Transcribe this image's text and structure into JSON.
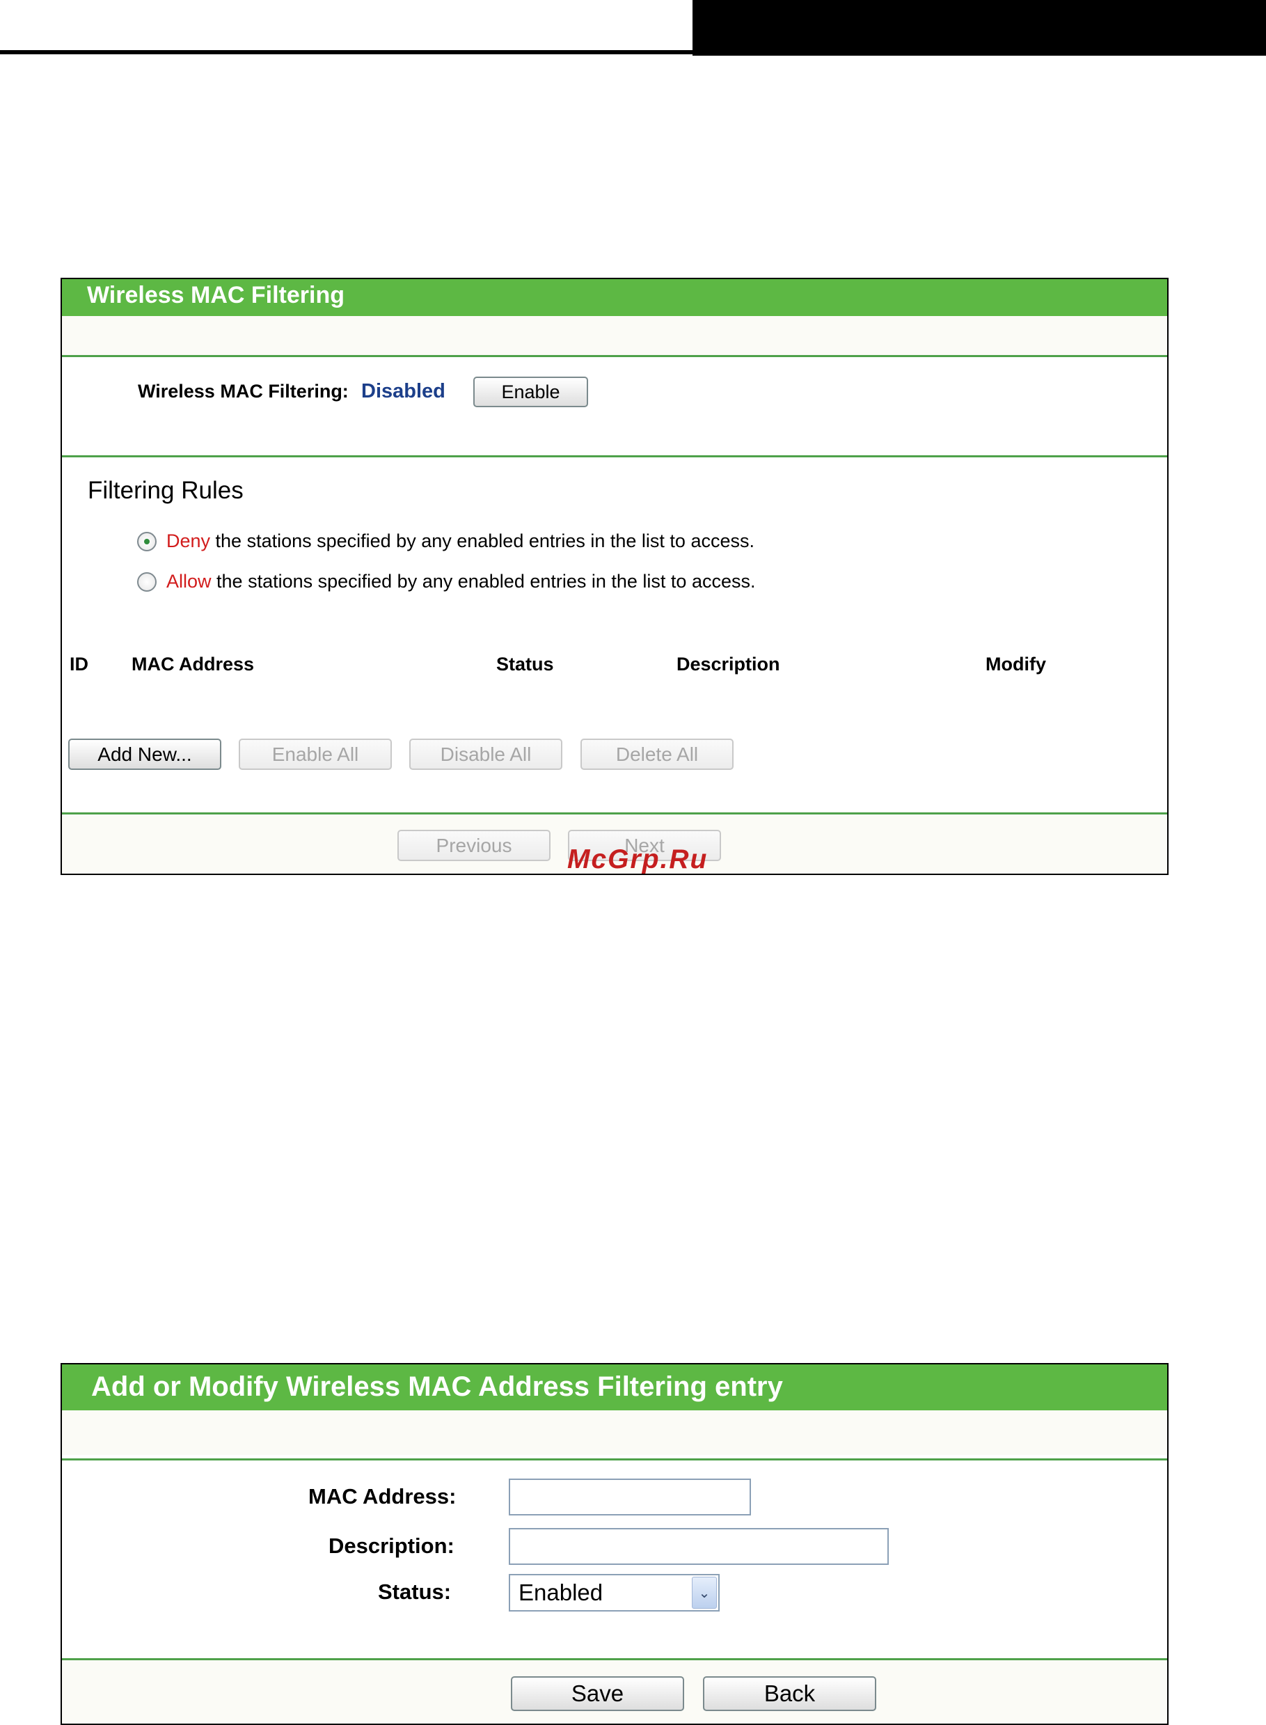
{
  "panel1": {
    "title": "Wireless MAC Filtering",
    "filtering_label": "Wireless MAC Filtering:",
    "filtering_status": "Disabled",
    "enable_button": "Enable",
    "section_heading": "Filtering Rules",
    "rules": [
      {
        "keyword": "Deny",
        "text": " the stations specified by any enabled entries in the list to access.",
        "selected": true
      },
      {
        "keyword": "Allow",
        "text": " the stations specified by any enabled entries in the list to access.",
        "selected": false
      }
    ],
    "table_headers": {
      "id": "ID",
      "mac": "MAC Address",
      "status": "Status",
      "description": "Description",
      "modify": "Modify"
    },
    "buttons": {
      "add_new": "Add New...",
      "enable_all": "Enable All",
      "disable_all": "Disable All",
      "delete_all": "Delete All",
      "previous": "Previous",
      "next": "Next"
    }
  },
  "watermark": "McGrp.Ru",
  "panel2": {
    "title": "Add or Modify Wireless MAC Address Filtering entry",
    "mac_label": "MAC Address:",
    "mac_value": "",
    "description_label": "Description:",
    "description_value": "",
    "status_label": "Status:",
    "status_value": "Enabled",
    "save_button": "Save",
    "back_button": "Back"
  },
  "colors": {
    "title_bar": "#5db844",
    "separator": "#4ea14a",
    "disabled_text": "#1c3f8a",
    "keyword": "#d21c1c"
  },
  "icons": {
    "select_arrow": "chevron-down-icon",
    "radio": "radio-button"
  }
}
